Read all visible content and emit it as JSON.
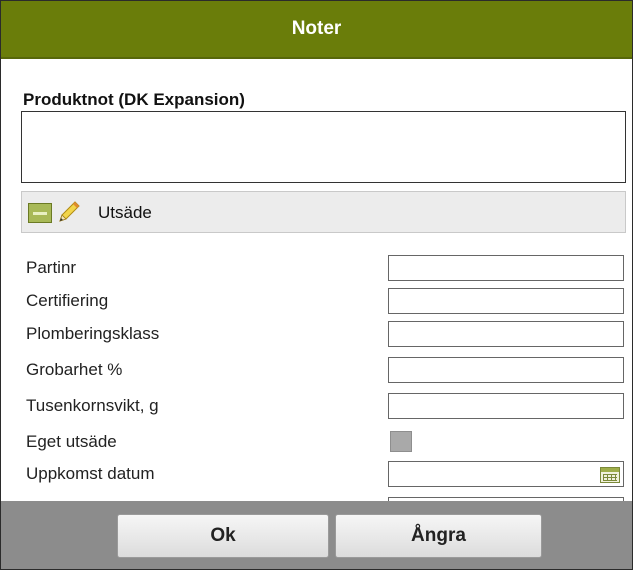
{
  "dialog": {
    "title": "Noter"
  },
  "note": {
    "label": "Produktnot (DK Expansion)",
    "value": ""
  },
  "section": {
    "title": "Utsäde",
    "collapse_icon": "minus-icon",
    "edit_icon": "pencil-icon"
  },
  "fields": [
    {
      "label": "Partinr",
      "type": "text",
      "value": ""
    },
    {
      "label": "Certifiering",
      "type": "text",
      "value": ""
    },
    {
      "label": "Plomberingsklass",
      "type": "text",
      "value": ""
    },
    {
      "label": "Grobarhet %",
      "type": "text",
      "value": ""
    },
    {
      "label": "Tusenkornsvikt, g",
      "type": "text",
      "value": ""
    },
    {
      "label": "Eget utsäde",
      "type": "checkbox",
      "checked": false
    },
    {
      "label": "Uppkomst datum",
      "type": "date",
      "value": "",
      "icon": "calendar-icon"
    }
  ],
  "buttons": {
    "ok": "Ok",
    "cancel": "Ångra"
  },
  "colors": {
    "titlebar": "#6a7d0a",
    "footer": "#8c8c8c",
    "accent": "#a8b957"
  }
}
